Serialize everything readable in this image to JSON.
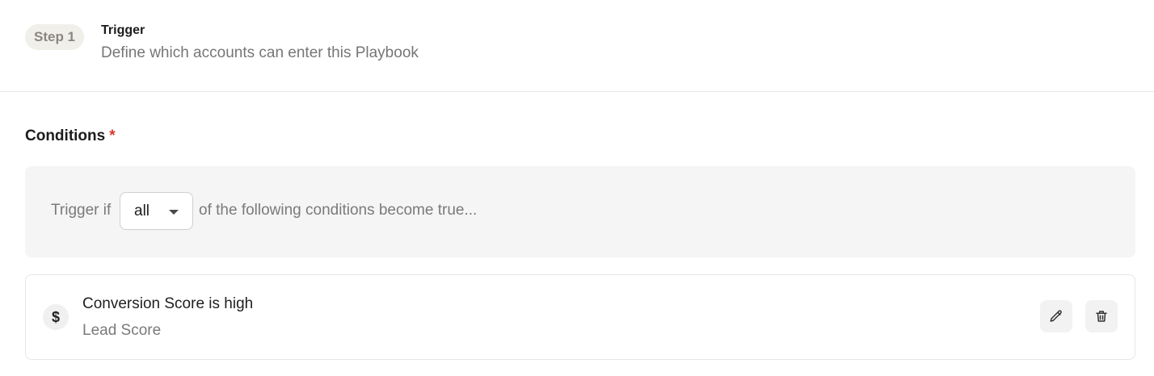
{
  "step": {
    "badge": "Step 1",
    "title": "Trigger",
    "description": "Define which accounts can enter this Playbook"
  },
  "conditions": {
    "label": "Conditions",
    "required_marker": "*",
    "trigger_prefix": "Trigger if",
    "match_mode": "all",
    "trigger_suffix": "of the following conditions become true...",
    "items": [
      {
        "icon": "dollar-icon",
        "icon_glyph": "$",
        "title": "Conversion Score is high",
        "subtitle": "Lead Score",
        "actions": [
          "pencil-icon",
          "trash-icon"
        ]
      }
    ]
  },
  "colors": {
    "required": "#d9362b",
    "badge_bg": "#f1efea",
    "panel_bg": "#f5f5f5"
  }
}
